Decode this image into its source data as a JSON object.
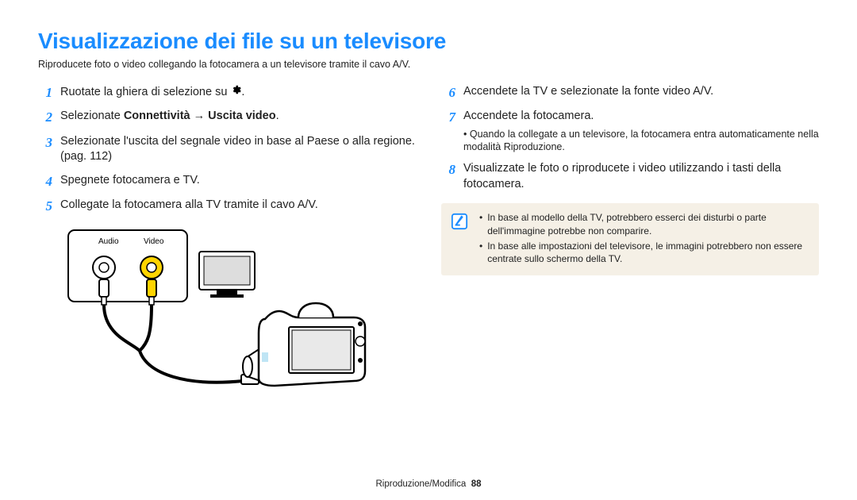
{
  "title": "Visualizzazione dei file su un televisore",
  "subtitle": "Riproducete foto o video collegando la fotocamera a un televisore tramite il cavo A/V.",
  "left_steps": [
    {
      "num": "1",
      "text_pre": "Ruotate la ghiera di selezione su ",
      "text_post": ".",
      "has_gear": true
    },
    {
      "num": "2",
      "prefix": "Selezionate ",
      "bold1": "Connettività",
      "arrow": " → ",
      "bold2": "Uscita video",
      "suffix": "."
    },
    {
      "num": "3",
      "text": "Selezionate l'uscita del segnale video in base al Paese o alla regione. (pag. 112)"
    },
    {
      "num": "4",
      "text": "Spegnete fotocamera e TV."
    },
    {
      "num": "5",
      "text": "Collegate la fotocamera alla TV tramite il cavo A/V."
    }
  ],
  "right_steps": [
    {
      "num": "6",
      "text": "Accendete la TV e selezionate la fonte video A/V."
    },
    {
      "num": "7",
      "text": "Accendete la fotocamera.",
      "sub": "Quando la collegate a un televisore, la fotocamera entra automaticamente nella modalità Riproduzione."
    },
    {
      "num": "8",
      "text": "Visualizzate le foto o riproducete i video utilizzando i tasti della fotocamera."
    }
  ],
  "diagram_labels": {
    "audio": "Audio",
    "video": "Video"
  },
  "notes": [
    "In base al modello della TV, potrebbero esserci dei disturbi o parte dell'immagine potrebbe non comparire.",
    "In base alle impostazioni del televisore, le immagini potrebbero non essere centrate sullo schermo della TV."
  ],
  "footer_section": "Riproduzione/Modifica",
  "footer_page": "88"
}
